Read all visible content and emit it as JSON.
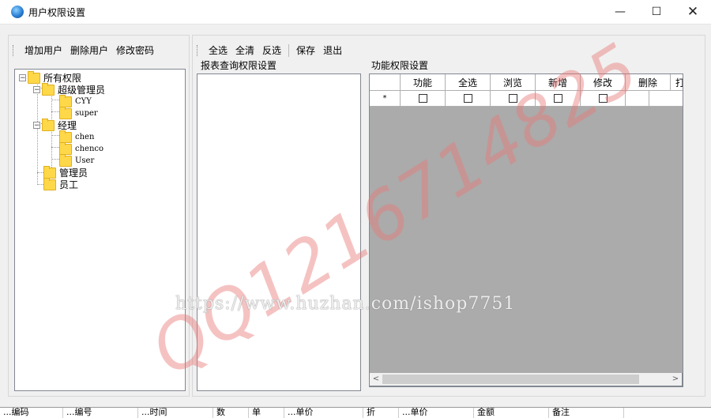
{
  "window": {
    "title": "用户权限设置",
    "minimize_icon": "—",
    "maximize_icon": "☐",
    "close_icon": "✕"
  },
  "left_toolbar": {
    "buttons": [
      "增加用户",
      "删除用户",
      "修改密码"
    ]
  },
  "right_toolbar": {
    "buttons": [
      "全选",
      "全清",
      "反选",
      "保存",
      "退出"
    ]
  },
  "tree": {
    "root": "所有权限",
    "groups": [
      {
        "label": "超级管理员",
        "children": [
          "CYY",
          "super"
        ]
      },
      {
        "label": "经理",
        "children": [
          "chen",
          "chenco",
          "User"
        ]
      },
      {
        "label": "管理员",
        "children": []
      },
      {
        "label": "员工",
        "children": []
      }
    ]
  },
  "report_panel": {
    "title": "报表查询权限设置"
  },
  "function_panel": {
    "title": "功能权限设置",
    "columns": [
      "功能",
      "全选",
      "浏览",
      "新增",
      "修改",
      "删除",
      "打"
    ],
    "new_row_marker": "*"
  },
  "watermark": {
    "text": "QQ1216714825",
    "url": "https://www.huzhan.com/ishop7751"
  },
  "bottom_strip": {
    "cells": [
      "...编码",
      "...编号",
      "...时间",
      "数",
      "单",
      "...单价",
      "折",
      "...单价",
      "金额",
      "备注"
    ]
  }
}
